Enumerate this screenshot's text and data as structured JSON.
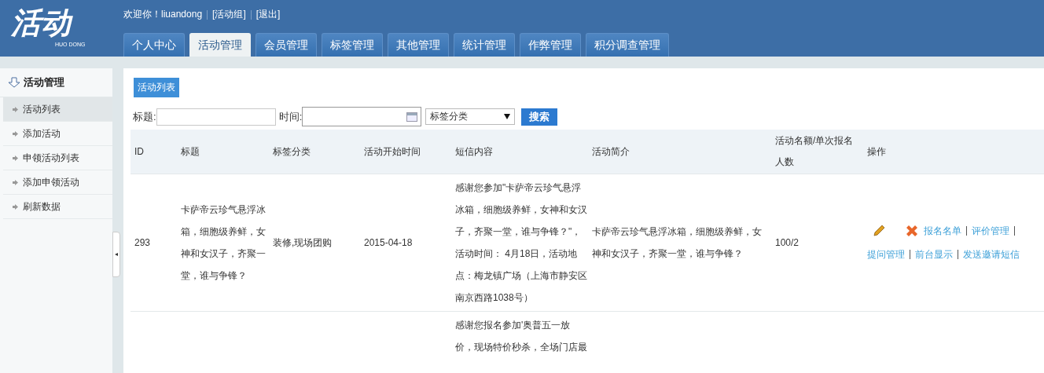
{
  "logo": {
    "title": "活动",
    "subtitle": "HUO DONG"
  },
  "user_bar": {
    "greeting": "欢迎你！liuandong",
    "links": [
      "[活动组]",
      "[退出]"
    ]
  },
  "nav_tabs": [
    {
      "label": "个人中心",
      "selected": false
    },
    {
      "label": "活动管理",
      "selected": true
    },
    {
      "label": "会员管理",
      "selected": false
    },
    {
      "label": "标签管理",
      "selected": false
    },
    {
      "label": "其他管理",
      "selected": false
    },
    {
      "label": "统计管理",
      "selected": false
    },
    {
      "label": "作弊管理",
      "selected": false
    },
    {
      "label": "积分调查管理",
      "selected": false
    }
  ],
  "sidebar": {
    "heading": "活动管理",
    "items": [
      {
        "label": "活动列表",
        "selected": true
      },
      {
        "label": "添加活动",
        "selected": false
      },
      {
        "label": "申领活动列表",
        "selected": false
      },
      {
        "label": "添加申领活动",
        "selected": false
      },
      {
        "label": "刷新数据",
        "selected": false
      }
    ],
    "collapse_handle": "◂"
  },
  "page_title": "活动列表",
  "filters": {
    "title_label": "标题:",
    "time_label": "时间:",
    "tag_select": "标签分类",
    "search_button": "搜索"
  },
  "table": {
    "columns": [
      "ID",
      "标题",
      "标签分类",
      "活动开始时间",
      "短信内容",
      "活动简介",
      [
        "活动名额/单次报名",
        "人数"
      ],
      "操作"
    ],
    "rows": [
      {
        "id": "293",
        "title": [
          "卡萨帝云珍气悬浮冰",
          "箱，细胞级养鲜，女",
          "神和女汉子，齐聚一",
          "堂，谁与争锋？"
        ],
        "tags": "装修,现场团购",
        "start": "2015-04-18",
        "sms": [
          "感谢您参加\"卡萨帝云珍气悬浮",
          "冰箱，细胞级养鲜，女神和女汉",
          "子，齐聚一堂，谁与争锋？\"，",
          "活动时间： 4月18日，活动地",
          "点：梅龙镇广场（上海市静安区",
          "南京西路1038号）"
        ],
        "intro": [
          "卡萨帝云珍气悬浮冰箱，细胞级养鲜，女",
          "神和女汉子，齐聚一堂，谁与争锋？"
        ],
        "quota": "100/2",
        "actions": [
          "报名名单",
          "评价管理",
          "提问管理",
          "前台显示",
          "发送邀请短信"
        ]
      },
      {
        "id": "",
        "title": [],
        "tags": "",
        "start": "",
        "sms": [
          "感谢您报名参加'奥普五一放",
          "价，现场特价秒杀，全场门店最"
        ],
        "intro": [],
        "quota": "",
        "actions": []
      }
    ]
  }
}
